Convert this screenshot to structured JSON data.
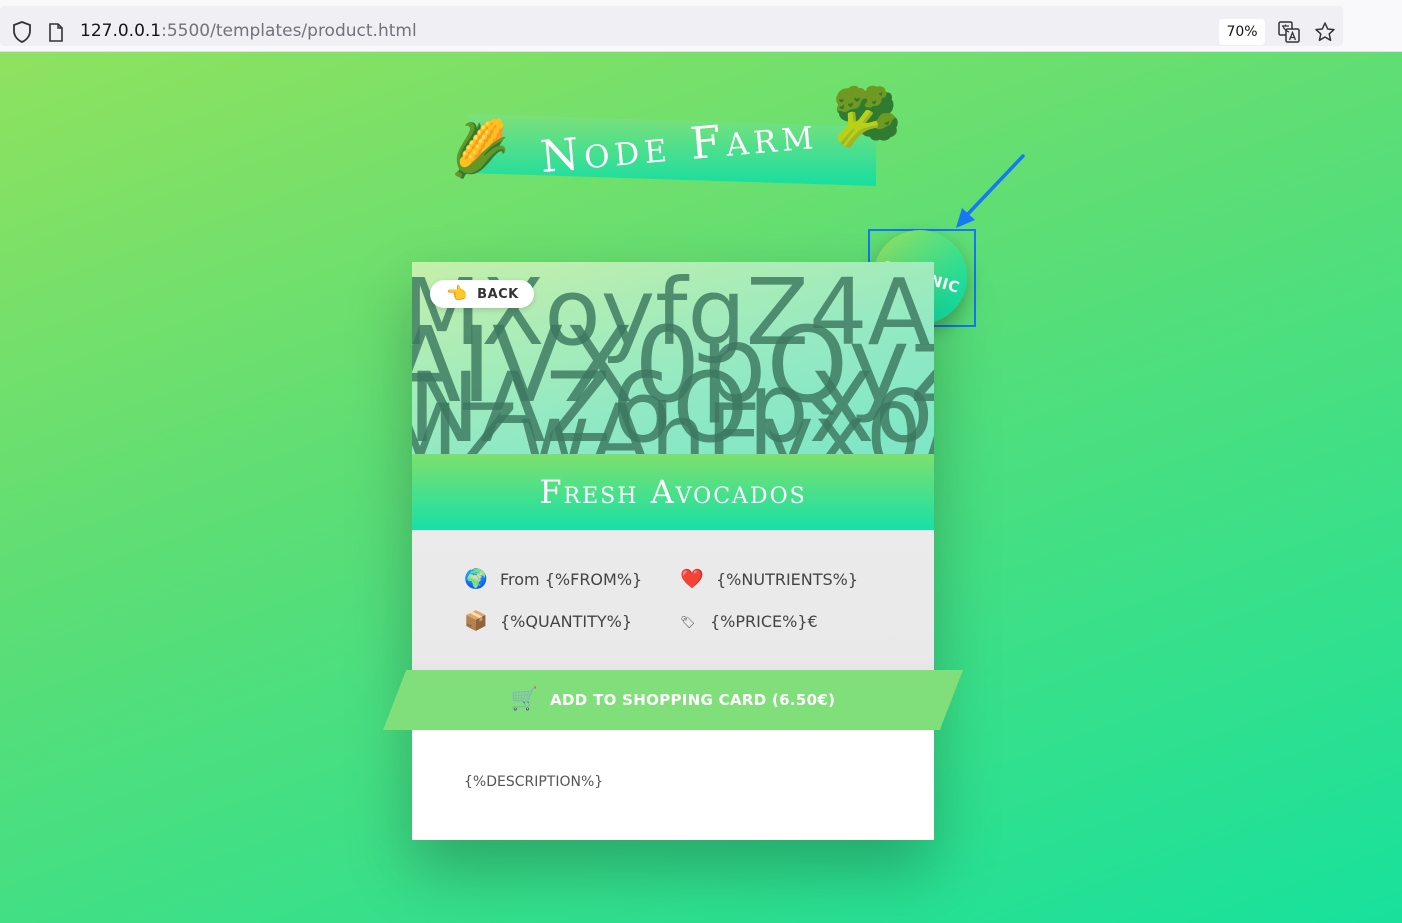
{
  "browser": {
    "url_host": "127.0.0.1",
    "url_rest": ":5500/templates/product.html",
    "zoom": "70%",
    "icons": [
      "shield-icon",
      "page-icon",
      "translate-icon",
      "bookmark-star-icon"
    ]
  },
  "site": {
    "title": "Node Farm",
    "title_emojis": [
      "🌽",
      "🥦"
    ]
  },
  "badge": {
    "label": "ORGANIC"
  },
  "product": {
    "back_label": "BACK",
    "back_emoji": "👈",
    "name": "Fresh Avocados",
    "details": {
      "from": {
        "emoji": "🌍",
        "text": "From {%FROM%}"
      },
      "nutrients": {
        "emoji": "❤️",
        "text": "{%NUTRIENTS%}"
      },
      "quantity": {
        "emoji": "📦",
        "text": "{%QUANTITY%}"
      },
      "price": {
        "emoji": "🏷",
        "text": "{%PRICE%}€"
      }
    },
    "cart_label": "ADD TO SHOPPING CARD (6.50€)",
    "cart_emoji": "🛒",
    "description": "{%DESCRIPTION%}"
  },
  "colors": {
    "bg_start": "#8fe25f",
    "bg_end": "#18e19c",
    "cart_button": "#80df7a",
    "annotation": "#1877f2"
  }
}
